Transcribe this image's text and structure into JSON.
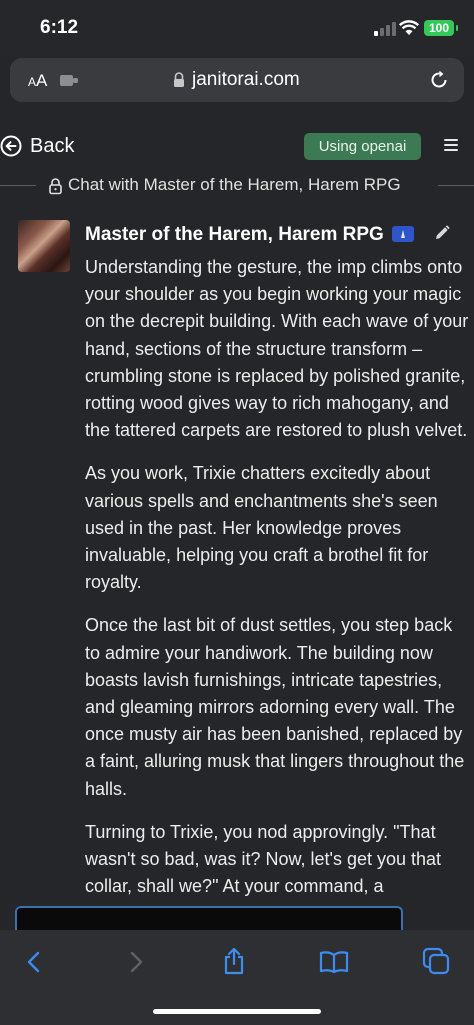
{
  "status_bar": {
    "time": "6:12",
    "battery": "100"
  },
  "browser": {
    "aa_label": "A",
    "aa_label_large": "A",
    "url": "janitorai.com"
  },
  "header": {
    "back_label": "Back",
    "model_badge": "Using openai",
    "chat_title": "Chat with Master of the Harem, Harem RPG"
  },
  "message": {
    "character_name": "Master of the Harem, Harem RPG",
    "paragraphs": [
      "Understanding the gesture, the imp climbs onto your shoulder as you begin working your magic on the decrepit building. With each wave of your hand, sections of the structure transform – crumbling stone is replaced by polished granite, rotting wood gives way to rich mahogany, and the tattered carpets are restored to plush velvet.",
      "As you work, Trixie chatters excitedly about various spells and enchantments she's seen used in the past. Her knowledge proves invaluable, helping you craft a brothel fit for royalty.",
      "Once the last bit of dust settles, you step back to admire your handiwork. The building now boasts lavish furnishings, intricate tapestries, and gleaming mirrors adorning every wall. The once musty air has been banished, replaced by a faint, alluring musk that lingers throughout the halls.",
      "Turning to Trixie, you nod approvingly. \"That wasn't so bad, was it? Now, let's get you that collar, shall we?\" At your command, a"
    ]
  },
  "icons": {
    "back": "back-circle-icon",
    "menu": "hamburger-menu-icon",
    "lock": "lock-icon",
    "edit": "pencil-edit-icon",
    "reload": "reload-icon",
    "toolbar": [
      "chevron-left-icon",
      "chevron-right-icon",
      "share-icon",
      "bookmarks-icon",
      "tabs-icon"
    ]
  },
  "colors": {
    "accent": "#3b7a52",
    "link_blue": "#3d8cf0",
    "background": "#25262a"
  }
}
